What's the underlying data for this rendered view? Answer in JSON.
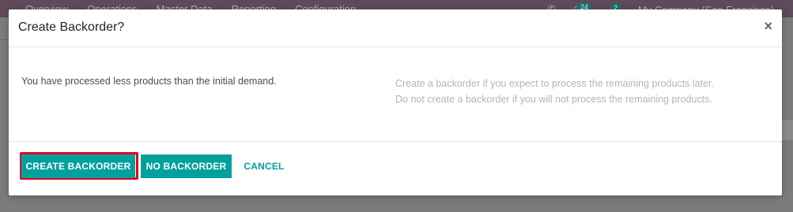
{
  "background_app": {
    "menu": [
      "Overview",
      "Operations",
      "Master Data",
      "Reporting",
      "Configuration"
    ],
    "activity_badge": "24",
    "message_badge": "2",
    "company": "My Company (San Francisco)"
  },
  "dialog": {
    "title": "Create Backorder?",
    "close_glyph": "×",
    "message": "You have processed less products than the initial demand.",
    "help_line_1": "Create a backorder if you expect to process the remaining products later.",
    "help_line_2": "Do not create a backorder if you will not process the remaining products.",
    "buttons": {
      "create_backorder": "CREATE BACKORDER",
      "no_backorder": "NO BACKORDER",
      "cancel": "CANCEL"
    },
    "highlight_color": "#e0001b",
    "accent_color": "#00a09d"
  }
}
